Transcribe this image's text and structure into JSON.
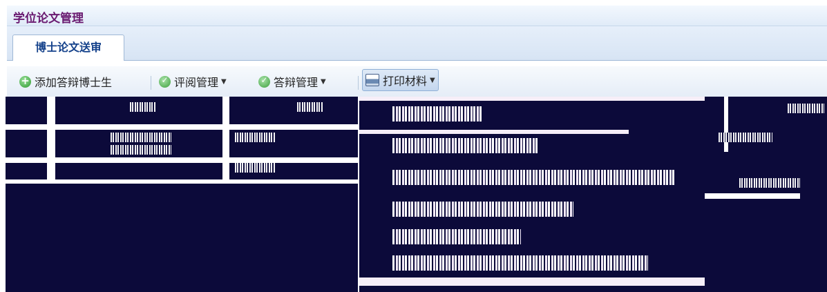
{
  "panel": {
    "title": "学位论文管理"
  },
  "tabs": [
    {
      "label": "博士论文送审"
    }
  ],
  "toolbar": {
    "add_label": "添加答辩博士生",
    "review_label": "评阅管理",
    "defense_label": "答辩管理",
    "print_label": "打印材料"
  },
  "icons": {
    "add": "add-circle-icon",
    "review": "check-circle-icon",
    "defense": "check-circle-icon",
    "print": "printer-icon",
    "dropdown": "chevron-down-icon"
  },
  "colors": {
    "title": "#6a1b71",
    "tab_text": "#15428b",
    "corrupt_bg": "#0c0a3a"
  }
}
